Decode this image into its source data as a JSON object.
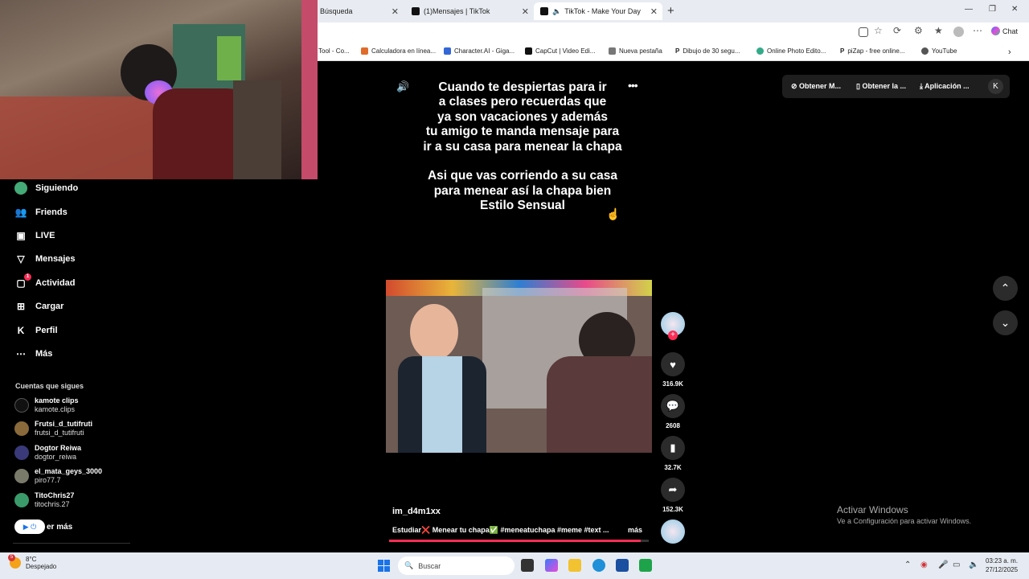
{
  "browser": {
    "tabs": [
      {
        "label": "Búsqueda"
      },
      {
        "label": "(1)Mensajes | TikTok"
      },
      {
        "label": "TikTok - Make Your Day"
      }
    ],
    "chat_label": "Chat",
    "bookmarks": [
      "Tool - Co...",
      "Calculadora en línea...",
      "Character.AI - Giga...",
      "CapCut | Video Edi...",
      "Nueva pestaña",
      "Dibujo de 30 segu...",
      "Online Photo Edito...",
      "piZap - free online...",
      "YouTube"
    ]
  },
  "sidebar": {
    "items": [
      {
        "label": "Siguiendo",
        "icon": "following-avatar-icon"
      },
      {
        "label": "Friends",
        "icon": "friends-icon"
      },
      {
        "label": "LIVE",
        "icon": "live-icon"
      },
      {
        "label": "Mensajes",
        "icon": "messages-icon"
      },
      {
        "label": "Actividad",
        "icon": "activity-icon",
        "badge": "1"
      },
      {
        "label": "Cargar",
        "icon": "upload-icon"
      },
      {
        "label": "Perfil",
        "icon": "profile-icon"
      },
      {
        "label": "Más",
        "icon": "more-icon"
      }
    ],
    "following_title": "Cuentas que sigues",
    "accounts": [
      {
        "name": "kamote clips",
        "handle": "kamote.clips"
      },
      {
        "name": "Frutsi_d_tutifruti",
        "handle": "frutsi_d_tutifruti"
      },
      {
        "name": "Dogtor Reiwa",
        "handle": "dogtor_reiwa"
      },
      {
        "name": "el_mata_geys_3000",
        "handle": "piro77.7"
      },
      {
        "name": "TitoChris27",
        "handle": "titochris.27"
      }
    ],
    "see_more": "er más"
  },
  "video": {
    "caption_lines": [
      "Cuando te despiertas para ir",
      "a clases pero recuerdas que",
      "ya son vacaciones y además",
      "tu amigo te manda mensaje para",
      "ir a su casa para menear la chapa",
      "",
      "Asi que vas corriendo a su casa",
      "para menear así la chapa bien",
      "Estilo Sensual"
    ],
    "author": "im_d4m1xx",
    "description": "Estudiar❌ Menear tu chapa✅ #meneatuchapa #meme #text ...",
    "more_label": "más",
    "progress": 0.97,
    "stats": {
      "likes": "316.9K",
      "comments": "2608",
      "saves": "32.7K",
      "shares": "152.3K"
    }
  },
  "topbar": {
    "get_coins": "Obtener M...",
    "get_app": "Obtener la ...",
    "app": "Aplicación ...",
    "profile_initial": "K"
  },
  "watermark": {
    "line1": "Activar Windows",
    "line2": "Ve a Configuración para activar Windows."
  },
  "taskbar": {
    "weather_temp": "8°C",
    "weather_desc": "Despejado",
    "weather_badge": "5",
    "search_placeholder": "Buscar",
    "time": "03:23 a. m.",
    "date": "27/12/2025"
  },
  "colors": {
    "accent": "#fe2c55",
    "background": "#000000",
    "button_bg": "#2b2b2b"
  }
}
